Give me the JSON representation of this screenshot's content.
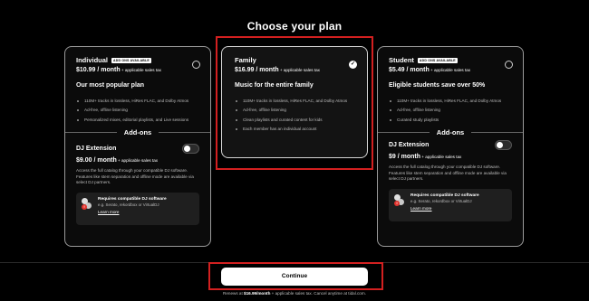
{
  "page": {
    "title": "Choose your plan"
  },
  "plans": [
    {
      "name": "Individual",
      "badge": "ADD ONS AVAILABLE",
      "price": "$10.99",
      "period": " / month",
      "tax": " + applicable sales tax",
      "tagline": "Our most popular plan",
      "features": [
        "110M+ tracks in lossless, HiRes FLAC, and Dolby Atmos",
        "Ad-free, offline listening",
        "Personalized mixes, editorial playlists, and Live sessions"
      ],
      "selected": false
    },
    {
      "name": "Family",
      "price": "$16.99",
      "period": " / month",
      "tax": " + applicable sales tax",
      "tagline": "Music for the entire family",
      "features": [
        "110M+ tracks in lossless, HiRes FLAC, and Dolby Atmos",
        "Ad-free, offline listening",
        "Clean playlists and curated content for kids",
        "Each member has an individual account"
      ],
      "selected": true,
      "check_glyph": "✓"
    },
    {
      "name": "Student",
      "badge": "ADD ONS AVAILABLE",
      "price": "$5.49",
      "period": " / month",
      "tax": " + applicable sales tax",
      "tagline": "Eligible students save over 50%",
      "features": [
        "110M+ tracks in lossless, HiRes FLAC, and Dolby Atmos",
        "Ad-free, offline listening",
        "Curated study playlists"
      ],
      "selected": false
    }
  ],
  "addons": {
    "heading": "Add-ons",
    "individual": {
      "name": "DJ Extension",
      "price": "$9.00",
      "period": " / month",
      "tax": " + applicable sales tax",
      "description": "Access the full catalog through your compatible DJ software. Features like stem separation and offline mode are available via select DJ partners.",
      "requirement_title": "Requires compatible DJ software",
      "requirement_sub": "e.g. Serato, rekordbox or VirtualDJ",
      "link": "Learn more",
      "enabled": false
    },
    "student": {
      "name": "DJ Extension",
      "price": "$9",
      "period": " / month",
      "tax": " + applicable sales tax",
      "description": "Access the full catalog through your compatible DJ software. Features like stem separation and offline mode are available via select DJ partners.",
      "requirement_title": "Requires compatible DJ software",
      "requirement_sub": "e.g. Serato, rekordbox or VirtualDJ",
      "link": "Learn more",
      "enabled": false
    }
  },
  "footer": {
    "continue_label": "Continue",
    "renewal_prefix": "Renews at ",
    "renewal_price": "$16.99/month",
    "renewal_suffix": " + applicable sales tax. Cancel anytime at tidal.com."
  },
  "colors": {
    "background": "#000000",
    "highlight": "#d32020",
    "button": "#ffffff"
  }
}
